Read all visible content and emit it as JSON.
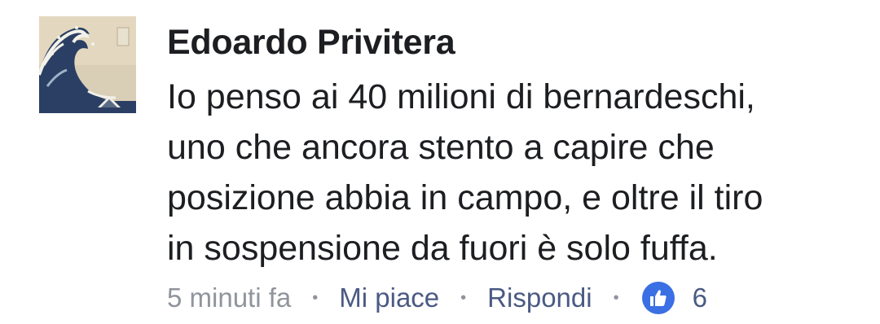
{
  "comment": {
    "author": "Edoardo Privitera",
    "lines": [
      "Io penso ai 40 milioni di bernardeschi,",
      "uno che ancora stento a capire che",
      "posizione abbia in campo, e oltre il tiro",
      "in sospensione da fuori è solo fuffa."
    ],
    "timestamp": "5 minuti fa",
    "separator": "•",
    "like_label": "Mi piace",
    "reply_label": "Rispondi",
    "reaction_icon": "like-icon",
    "reaction_count": "6",
    "avatar_icon": "great-wave-avatar",
    "colors": {
      "author": "#1c1e21",
      "timestamp": "#90949c",
      "link": "#4a5a84",
      "like_badge": "#3b6fe4"
    }
  }
}
